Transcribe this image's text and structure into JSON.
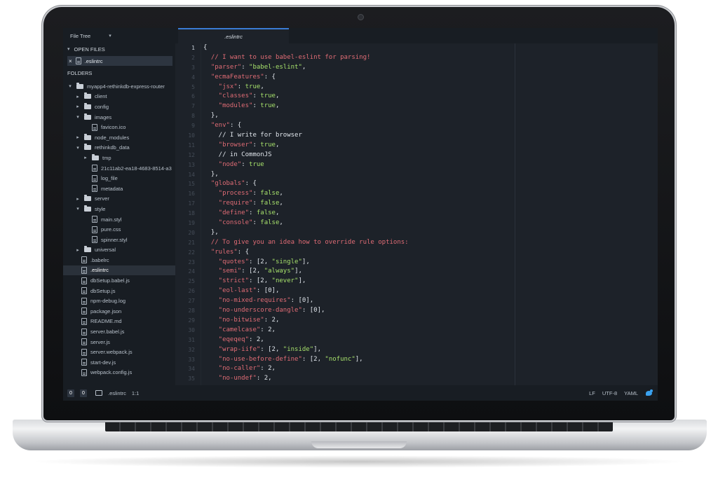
{
  "colors": {
    "comment": "#e06c75",
    "string": "#a6e06b",
    "punctuation": "#dfe4ea",
    "accent": "#3a7bd5"
  },
  "sidebar": {
    "header": "File Tree",
    "open_files_label": "OPEN FILES",
    "open_file": ".eslintrc",
    "folders_label": "FOLDERS",
    "tree": [
      {
        "label": "myapp4-rethinkdb-express-router",
        "kind": "folder",
        "depth": 0,
        "expanded": true
      },
      {
        "label": "client",
        "kind": "folder",
        "depth": 1,
        "expanded": false
      },
      {
        "label": "config",
        "kind": "folder",
        "depth": 1,
        "expanded": false
      },
      {
        "label": "images",
        "kind": "folder",
        "depth": 1,
        "expanded": true
      },
      {
        "label": "favicon.ico",
        "kind": "file",
        "depth": 2
      },
      {
        "label": "node_modules",
        "kind": "folder",
        "depth": 1,
        "expanded": false
      },
      {
        "label": "rethinkdb_data",
        "kind": "folder",
        "depth": 1,
        "expanded": true
      },
      {
        "label": "tmp",
        "kind": "folder",
        "depth": 2,
        "expanded": false
      },
      {
        "label": "21c11ab2-ea18-4683-8514-a3",
        "kind": "file",
        "depth": 2
      },
      {
        "label": "log_file",
        "kind": "file",
        "depth": 2
      },
      {
        "label": "metadata",
        "kind": "file",
        "depth": 2
      },
      {
        "label": "server",
        "kind": "folder",
        "depth": 1,
        "expanded": false
      },
      {
        "label": "style",
        "kind": "folder",
        "depth": 1,
        "expanded": true
      },
      {
        "label": "main.styl",
        "kind": "file",
        "depth": 2
      },
      {
        "label": "pure.css",
        "kind": "file",
        "depth": 2
      },
      {
        "label": "spinner.styl",
        "kind": "file",
        "depth": 2
      },
      {
        "label": "universal",
        "kind": "folder",
        "depth": 1,
        "expanded": false
      },
      {
        "label": ".babelrc",
        "kind": "file",
        "depth": 1
      },
      {
        "label": ".eslintrc",
        "kind": "file",
        "depth": 1,
        "selected": true
      },
      {
        "label": "dbSetup.babel.js",
        "kind": "file",
        "depth": 1
      },
      {
        "label": "dbSetup.js",
        "kind": "file",
        "depth": 1
      },
      {
        "label": "npm-debug.log",
        "kind": "file",
        "depth": 1
      },
      {
        "label": "package.json",
        "kind": "file",
        "depth": 1
      },
      {
        "label": "README.md",
        "kind": "file",
        "depth": 1
      },
      {
        "label": "server.babel.js",
        "kind": "file",
        "depth": 1
      },
      {
        "label": "server.js",
        "kind": "file",
        "depth": 1
      },
      {
        "label": "server.webpack.js",
        "kind": "file",
        "depth": 1
      },
      {
        "label": "start-dev.js",
        "kind": "file",
        "depth": 1
      },
      {
        "label": "webpack.config.js",
        "kind": "file",
        "depth": 1
      }
    ]
  },
  "tab": {
    "title": ".eslintrc"
  },
  "editor": {
    "active_line": 1,
    "lines": [
      [
        {
          "t": "{",
          "c": "punctuation"
        }
      ],
      [
        {
          "t": "  // I want to use babel-eslint for parsing!",
          "c": "comment"
        }
      ],
      [
        {
          "t": "  \"parser\"",
          "c": "comment"
        },
        {
          "t": ": ",
          "c": "punctuation"
        },
        {
          "t": "\"babel-eslint\"",
          "c": "string"
        },
        {
          "t": ",",
          "c": "punctuation"
        }
      ],
      [
        {
          "t": "  \"ecmaFeatures\"",
          "c": "comment"
        },
        {
          "t": ": {",
          "c": "punctuation"
        }
      ],
      [
        {
          "t": "    \"jsx\"",
          "c": "comment"
        },
        {
          "t": ": ",
          "c": "punctuation"
        },
        {
          "t": "true",
          "c": "string"
        },
        {
          "t": ",",
          "c": "punctuation"
        }
      ],
      [
        {
          "t": "    \"classes\"",
          "c": "comment"
        },
        {
          "t": ": ",
          "c": "punctuation"
        },
        {
          "t": "true",
          "c": "string"
        },
        {
          "t": ",",
          "c": "punctuation"
        }
      ],
      [
        {
          "t": "    \"modules\"",
          "c": "comment"
        },
        {
          "t": ": ",
          "c": "punctuation"
        },
        {
          "t": "true",
          "c": "string"
        },
        {
          "t": ",",
          "c": "punctuation"
        }
      ],
      [
        {
          "t": "  },",
          "c": "punctuation"
        }
      ],
      [
        {
          "t": "  \"env\"",
          "c": "comment"
        },
        {
          "t": ": {",
          "c": "punctuation"
        }
      ],
      [
        {
          "t": "    // I write for browser",
          "c": "punctuation"
        }
      ],
      [
        {
          "t": "    \"browser\"",
          "c": "comment"
        },
        {
          "t": ": ",
          "c": "punctuation"
        },
        {
          "t": "true",
          "c": "string"
        },
        {
          "t": ",",
          "c": "punctuation"
        }
      ],
      [
        {
          "t": "    // in CommonJS",
          "c": "punctuation"
        }
      ],
      [
        {
          "t": "    \"node\"",
          "c": "comment"
        },
        {
          "t": ": ",
          "c": "punctuation"
        },
        {
          "t": "true",
          "c": "string"
        }
      ],
      [
        {
          "t": "  },",
          "c": "punctuation"
        }
      ],
      [
        {
          "t": "  \"globals\"",
          "c": "comment"
        },
        {
          "t": ": {",
          "c": "punctuation"
        }
      ],
      [
        {
          "t": "    \"process\"",
          "c": "comment"
        },
        {
          "t": ": ",
          "c": "punctuation"
        },
        {
          "t": "false",
          "c": "string"
        },
        {
          "t": ",",
          "c": "punctuation"
        }
      ],
      [
        {
          "t": "    \"require\"",
          "c": "comment"
        },
        {
          "t": ": ",
          "c": "punctuation"
        },
        {
          "t": "false",
          "c": "string"
        },
        {
          "t": ",",
          "c": "punctuation"
        }
      ],
      [
        {
          "t": "    \"define\"",
          "c": "comment"
        },
        {
          "t": ": ",
          "c": "punctuation"
        },
        {
          "t": "false",
          "c": "string"
        },
        {
          "t": ",",
          "c": "punctuation"
        }
      ],
      [
        {
          "t": "    \"console\"",
          "c": "comment"
        },
        {
          "t": ": ",
          "c": "punctuation"
        },
        {
          "t": "false",
          "c": "string"
        },
        {
          "t": ",",
          "c": "punctuation"
        }
      ],
      [
        {
          "t": "  },",
          "c": "punctuation"
        }
      ],
      [
        {
          "t": "  // To give you an idea how to override rule options:",
          "c": "comment"
        }
      ],
      [
        {
          "t": "  \"rules\"",
          "c": "comment"
        },
        {
          "t": ": {",
          "c": "punctuation"
        }
      ],
      [
        {
          "t": "    \"quotes\"",
          "c": "comment"
        },
        {
          "t": ": [2, ",
          "c": "punctuation"
        },
        {
          "t": "\"single\"",
          "c": "string"
        },
        {
          "t": "],",
          "c": "punctuation"
        }
      ],
      [
        {
          "t": "    \"semi\"",
          "c": "comment"
        },
        {
          "t": ": [2, ",
          "c": "punctuation"
        },
        {
          "t": "\"always\"",
          "c": "string"
        },
        {
          "t": "],",
          "c": "punctuation"
        }
      ],
      [
        {
          "t": "    \"strict\"",
          "c": "comment"
        },
        {
          "t": ": [2, ",
          "c": "punctuation"
        },
        {
          "t": "\"never\"",
          "c": "string"
        },
        {
          "t": "],",
          "c": "punctuation"
        }
      ],
      [
        {
          "t": "    \"eol-last\"",
          "c": "comment"
        },
        {
          "t": ": [0],",
          "c": "punctuation"
        }
      ],
      [
        {
          "t": "    \"no-mixed-requires\"",
          "c": "comment"
        },
        {
          "t": ": [0],",
          "c": "punctuation"
        }
      ],
      [
        {
          "t": "    \"no-underscore-dangle\"",
          "c": "comment"
        },
        {
          "t": ": [0],",
          "c": "punctuation"
        }
      ],
      [
        {
          "t": "    \"no-bitwise\"",
          "c": "comment"
        },
        {
          "t": ": 2,",
          "c": "punctuation"
        }
      ],
      [
        {
          "t": "    \"camelcase\"",
          "c": "comment"
        },
        {
          "t": ": 2,",
          "c": "punctuation"
        }
      ],
      [
        {
          "t": "    \"eqeqeq\"",
          "c": "comment"
        },
        {
          "t": ": 2,",
          "c": "punctuation"
        }
      ],
      [
        {
          "t": "    \"wrap-iife\"",
          "c": "comment"
        },
        {
          "t": ": [2, ",
          "c": "punctuation"
        },
        {
          "t": "\"inside\"",
          "c": "string"
        },
        {
          "t": "],",
          "c": "punctuation"
        }
      ],
      [
        {
          "t": "    \"no-use-before-define\"",
          "c": "comment"
        },
        {
          "t": ": [2, ",
          "c": "punctuation"
        },
        {
          "t": "\"nofunc\"",
          "c": "string"
        },
        {
          "t": "],",
          "c": "punctuation"
        }
      ],
      [
        {
          "t": "    \"no-caller\"",
          "c": "comment"
        },
        {
          "t": ": 2,",
          "c": "punctuation"
        }
      ],
      [
        {
          "t": "    \"no-undef\"",
          "c": "comment"
        },
        {
          "t": ": 2,",
          "c": "punctuation"
        }
      ]
    ]
  },
  "status": {
    "errors": "0",
    "warnings": "0",
    "file": ".eslintrc",
    "cursor": "1:1",
    "line_ending": "LF",
    "encoding": "UTF-8",
    "grammar": "YAML"
  },
  "icons": {
    "open_files_toggle": "chevron-down-icon",
    "close_open_file": "close-icon",
    "status_bird": "bird-icon"
  }
}
